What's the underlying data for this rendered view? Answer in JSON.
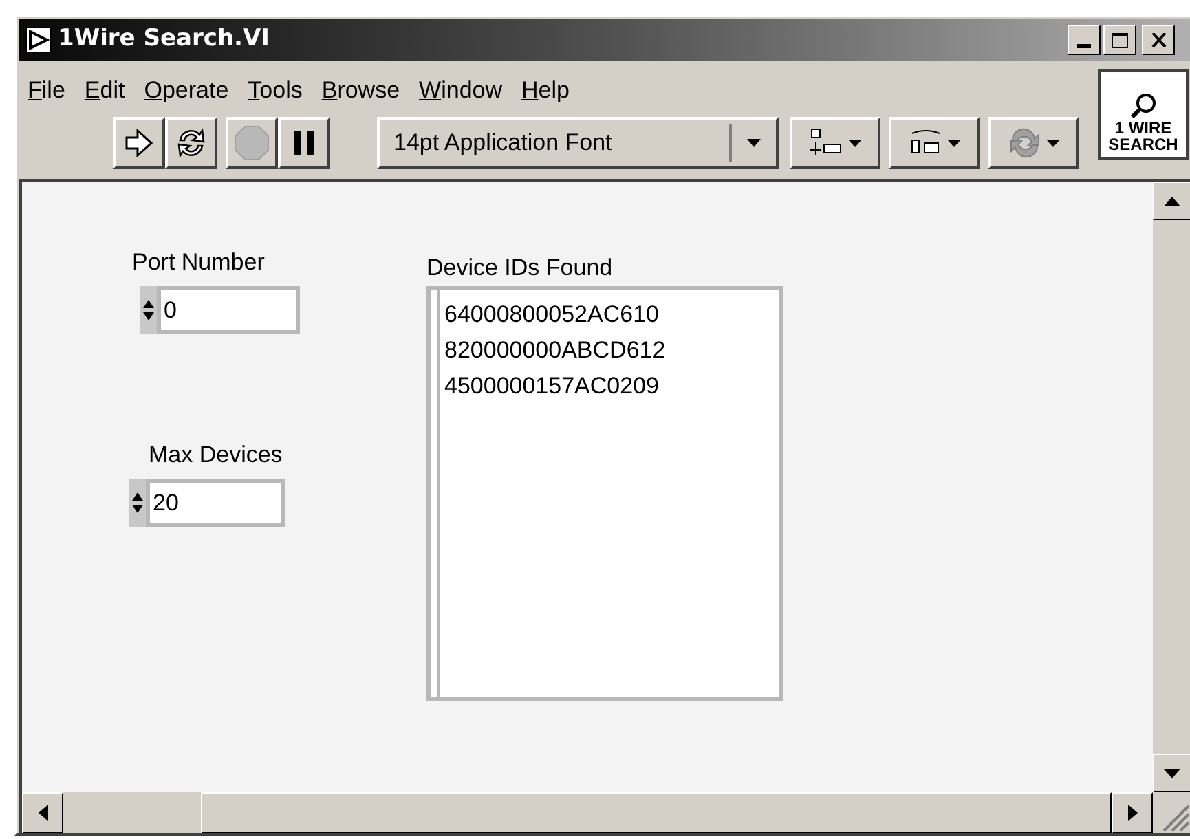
{
  "window": {
    "title": "1Wire Search.VI"
  },
  "menu": [
    "File",
    "Edit",
    "Operate",
    "Tools",
    "Browse",
    "Window",
    "Help"
  ],
  "toolbar": [
    {
      "kind": "run",
      "disabled": false
    },
    {
      "kind": "run_continuous",
      "disabled": false
    },
    {
      "kind": "abort",
      "disabled": true
    },
    {
      "kind": "pause",
      "disabled": false
    }
  ],
  "font_selector": {
    "value": "14pt Application Font"
  },
  "vi_icon": {
    "lines": [
      "1 WIRE",
      "SEARCH"
    ]
  },
  "controls": [
    {
      "label": "Port Number",
      "value": "0"
    },
    {
      "label": "Max Devices",
      "value": "20"
    }
  ],
  "listbox": {
    "label": "Device IDs Found",
    "items": [
      "64000800052AC610",
      "820000000ABCD612",
      "4500000157AC0209"
    ]
  }
}
